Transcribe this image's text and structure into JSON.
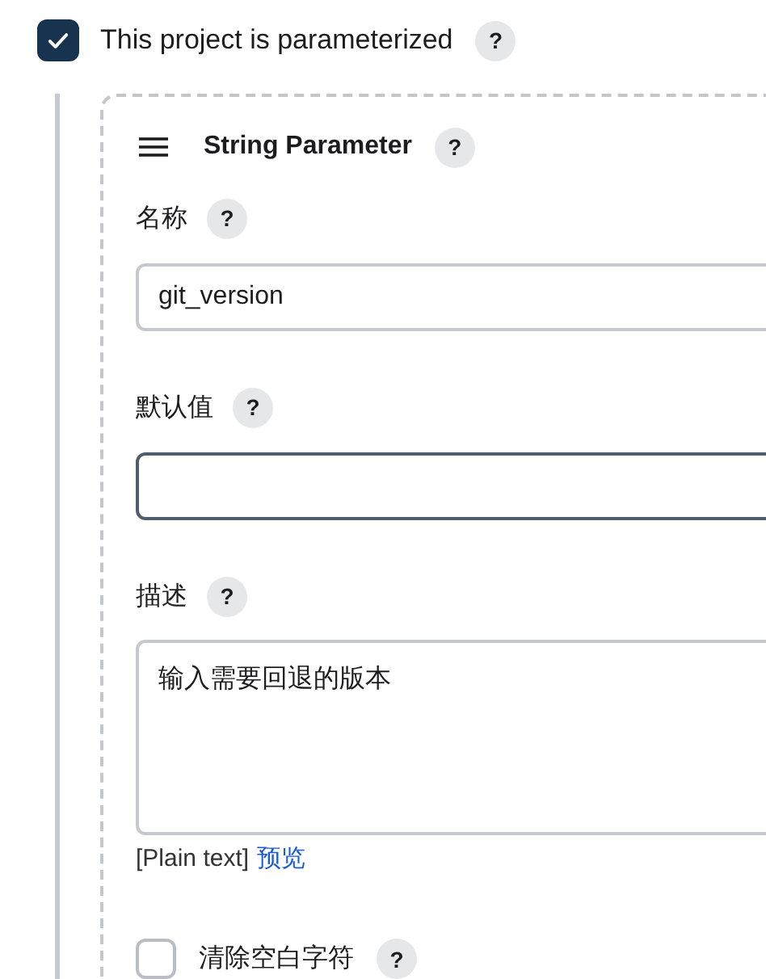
{
  "parameterized": {
    "label": "This project is parameterized",
    "help": "?",
    "checked": true
  },
  "parameter": {
    "title": "String Parameter",
    "help": "?",
    "fields": [
      {
        "kind": "input",
        "label": "名称",
        "help": "?",
        "value": "git_version",
        "focused": false
      },
      {
        "kind": "input",
        "label": "默认值",
        "help": "?",
        "focused": true
      },
      {
        "kind": "textarea",
        "label": "描述",
        "help": "?",
        "value": "输入需要回退的版本",
        "focused": false
      }
    ],
    "format": {
      "text": "[Plain text]",
      "link": "预览"
    },
    "trim": {
      "label": "清除空白字符",
      "help": "?",
      "checked": false
    }
  }
}
